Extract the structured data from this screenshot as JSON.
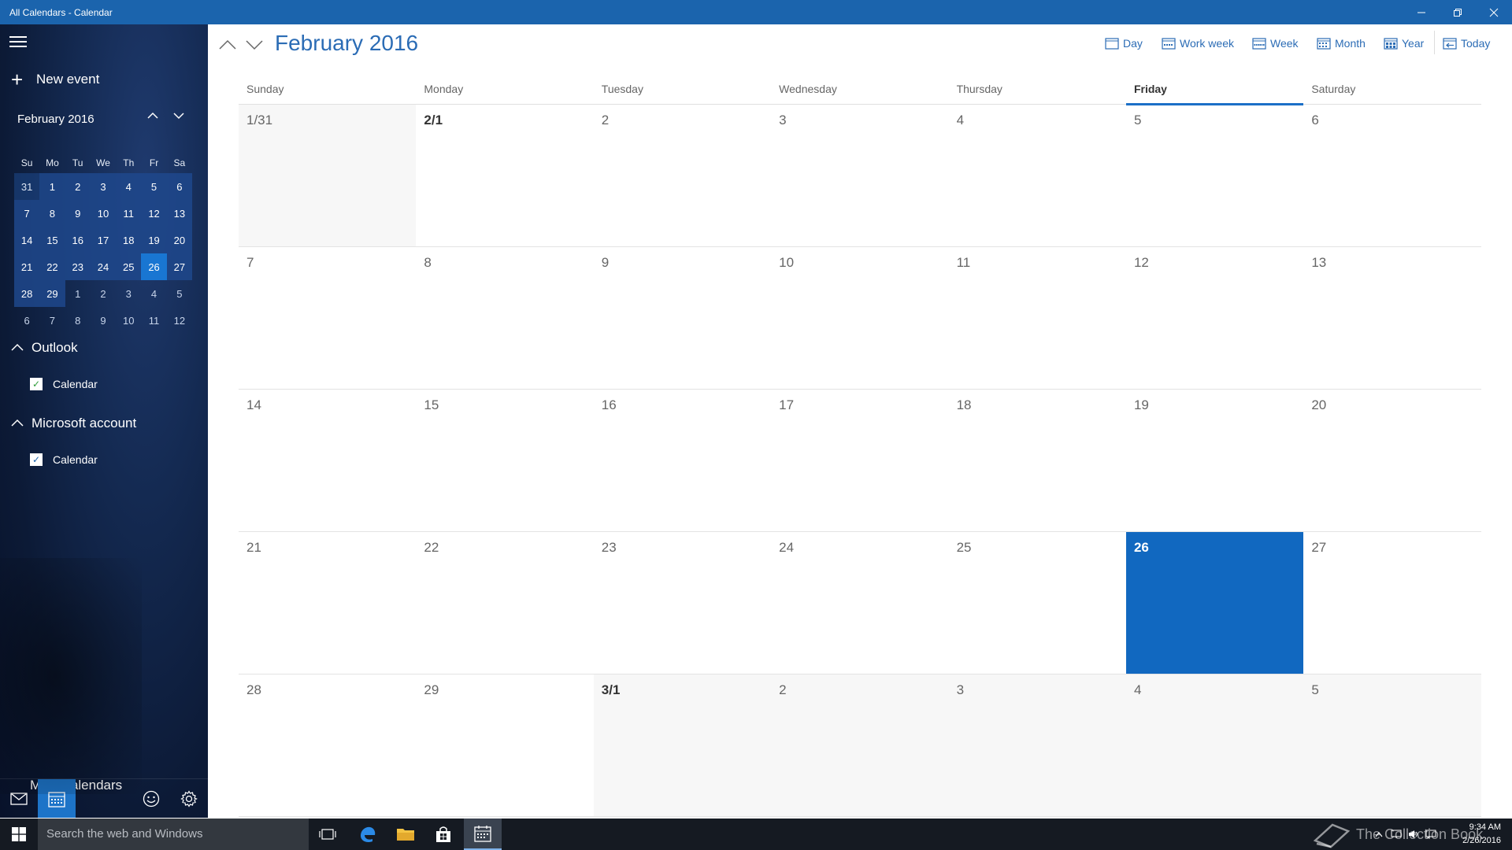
{
  "window": {
    "title": "All Calendars - Calendar",
    "min": "—",
    "restore": "❐",
    "close": "✕"
  },
  "sidebar": {
    "new_event_label": "New event",
    "mini_month_label": "February 2016",
    "mini_dow": [
      "Su",
      "Mo",
      "Tu",
      "We",
      "Th",
      "Fr",
      "Sa"
    ],
    "mini_weeks": [
      [
        "31",
        "1",
        "2",
        "3",
        "4",
        "5",
        "6"
      ],
      [
        "7",
        "8",
        "9",
        "10",
        "11",
        "12",
        "13"
      ],
      [
        "14",
        "15",
        "16",
        "17",
        "18",
        "19",
        "20"
      ],
      [
        "21",
        "22",
        "23",
        "24",
        "25",
        "26",
        "27"
      ],
      [
        "28",
        "29",
        "1",
        "2",
        "3",
        "4",
        "5"
      ],
      [
        "6",
        "7",
        "8",
        "9",
        "10",
        "11",
        "12"
      ]
    ],
    "accounts": [
      {
        "name": "Outlook",
        "calendar": "Calendar"
      },
      {
        "name": "Microsoft account",
        "calendar": "Calendar"
      }
    ],
    "more_calendars": "More calendars"
  },
  "header": {
    "month_title": "February 2016",
    "views": [
      {
        "label": "Day"
      },
      {
        "label": "Work week"
      },
      {
        "label": "Week"
      },
      {
        "label": "Month"
      },
      {
        "label": "Year"
      },
      {
        "label": "Today"
      }
    ]
  },
  "month_grid": {
    "weekdays": [
      "Sunday",
      "Monday",
      "Tuesday",
      "Wednesday",
      "Thursday",
      "Friday",
      "Saturday"
    ],
    "weeks": [
      [
        "1/31",
        "2/1",
        "2",
        "3",
        "4",
        "5",
        "6"
      ],
      [
        "7",
        "8",
        "9",
        "10",
        "11",
        "12",
        "13"
      ],
      [
        "14",
        "15",
        "16",
        "17",
        "18",
        "19",
        "20"
      ],
      [
        "21",
        "22",
        "23",
        "24",
        "25",
        "26",
        "27"
      ],
      [
        "28",
        "29",
        "3/1",
        "2",
        "3",
        "4",
        "5"
      ]
    ]
  },
  "taskbar": {
    "search_placeholder": "Search the web and Windows",
    "watermark": "The Collection Book",
    "time": "9:34 AM",
    "date": "2/26/2016"
  },
  "colors": {
    "accent": "#1b64ad",
    "today": "#1168c0",
    "sidebar_bg": "#0c1a36"
  }
}
